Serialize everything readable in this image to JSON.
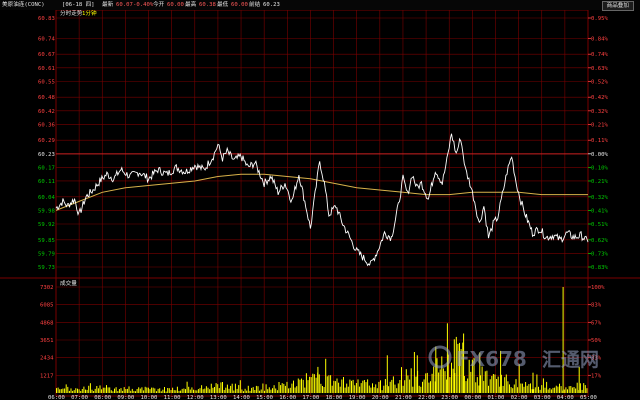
{
  "header": {
    "title": "美原油连(CONC)",
    "date": "[06-18 四]",
    "latest_label": "最新",
    "latest_value": "60.07",
    "change_value": "-0.40%",
    "today_open_label": "今开",
    "today_open_value": "60.00",
    "high_label": "最高",
    "high_value": "60.38",
    "low_label": "最低",
    "low_value": "60.00",
    "prev_settle_label": "前结",
    "prev_settle_value": "60.23",
    "add_button_label": "商品叠加"
  },
  "price_panel": {
    "title_label": "分时走势",
    "period_label": "1分钟"
  },
  "volume_panel": {
    "title_label": "成交量"
  },
  "watermark": "FX678 汇通网",
  "colors": {
    "grid": "#7a0000",
    "price_line": "#ffffff",
    "avg_line": "#d8b24a",
    "volume_bar": "#ffff00",
    "axis_red": "#ff4040",
    "axis_green": "#00c800",
    "axis_white": "#e6e6e6",
    "background": "#000000"
  },
  "chart_data": [
    {
      "type": "line",
      "title": "分时走势",
      "y_ticks": [
        "60.83",
        "60.74",
        "60.67",
        "60.61",
        "60.55",
        "60.48",
        "60.42",
        "60.36",
        "60.29",
        "60.23",
        "60.17",
        "60.11",
        "60.04",
        "59.98",
        "59.92",
        "59.85",
        "59.79",
        "59.73"
      ],
      "right_ticks": [
        "0.95%",
        "0.84%",
        "0.74%",
        "0.63%",
        "0.52%",
        "0.42%",
        "0.32%",
        "0.21%",
        "0.11%",
        "0.00%",
        "0.10%",
        "0.21%",
        "0.32%",
        "0.41%",
        "0.51%",
        "0.62%",
        "0.73%",
        "0.83%"
      ],
      "x_ticks": [
        "06:00",
        "07:00",
        "08:00",
        "09:00",
        "10:00",
        "11:00",
        "12:00",
        "13:00",
        "14:00",
        "15:00",
        "16:00",
        "17:00",
        "18:00",
        "19:00",
        "20:00",
        "21:00",
        "22:00",
        "23:00",
        "00:00",
        "01:00",
        "02:00",
        "03:00",
        "04:00",
        "05:00"
      ],
      "ylim": [
        59.73,
        60.83
      ],
      "series": [
        {
          "name": "价格",
          "points": [
            [
              0,
              59.99
            ],
            [
              0.3,
              60.02
            ],
            [
              0.5,
              60.0
            ],
            [
              0.8,
              60.03
            ],
            [
              1.0,
              59.96
            ],
            [
              1.3,
              60.04
            ],
            [
              1.6,
              60.07
            ],
            [
              1.9,
              60.11
            ],
            [
              2.2,
              60.14
            ],
            [
              2.5,
              60.12
            ],
            [
              2.8,
              60.16
            ],
            [
              3.2,
              60.13
            ],
            [
              3.6,
              60.15
            ],
            [
              4.0,
              60.12
            ],
            [
              4.4,
              60.16
            ],
            [
              4.8,
              60.14
            ],
            [
              5.2,
              60.17
            ],
            [
              5.6,
              60.15
            ],
            [
              6.0,
              60.18
            ],
            [
              6.4,
              60.16
            ],
            [
              6.8,
              60.22
            ],
            [
              7.0,
              60.27
            ],
            [
              7.2,
              60.21
            ],
            [
              7.4,
              60.24
            ],
            [
              7.7,
              60.2
            ],
            [
              8.0,
              60.22
            ],
            [
              8.3,
              60.17
            ],
            [
              8.6,
              60.19
            ],
            [
              9.0,
              60.1
            ],
            [
              9.3,
              60.13
            ],
            [
              9.6,
              60.06
            ],
            [
              9.9,
              60.1
            ],
            [
              10.2,
              60.02
            ],
            [
              10.5,
              60.14
            ],
            [
              10.8,
              60.0
            ],
            [
              11.0,
              59.9
            ],
            [
              11.2,
              60.05
            ],
            [
              11.4,
              60.2
            ],
            [
              11.6,
              60.1
            ],
            [
              11.8,
              59.96
            ],
            [
              12.1,
              60.0
            ],
            [
              12.4,
              59.92
            ],
            [
              12.7,
              59.86
            ],
            [
              13.0,
              59.8
            ],
            [
              13.3,
              59.77
            ],
            [
              13.6,
              59.74
            ],
            [
              13.9,
              59.8
            ],
            [
              14.2,
              59.88
            ],
            [
              14.5,
              59.86
            ],
            [
              14.8,
              60.0
            ],
            [
              15.0,
              60.12
            ],
            [
              15.2,
              60.05
            ],
            [
              15.4,
              60.14
            ],
            [
              15.6,
              60.08
            ],
            [
              15.8,
              60.1
            ],
            [
              16.1,
              60.03
            ],
            [
              16.4,
              60.16
            ],
            [
              16.7,
              60.1
            ],
            [
              16.9,
              60.2
            ],
            [
              17.1,
              60.32
            ],
            [
              17.3,
              60.23
            ],
            [
              17.5,
              60.3
            ],
            [
              17.7,
              60.16
            ],
            [
              17.9,
              60.1
            ],
            [
              18.1,
              60.02
            ],
            [
              18.3,
              59.92
            ],
            [
              18.5,
              60.0
            ],
            [
              18.7,
              59.86
            ],
            [
              18.9,
              59.92
            ],
            [
              19.1,
              59.95
            ],
            [
              19.3,
              60.05
            ],
            [
              19.5,
              60.15
            ],
            [
              19.7,
              60.22
            ],
            [
              19.9,
              60.1
            ],
            [
              20.1,
              60.02
            ],
            [
              20.3,
              59.96
            ],
            [
              20.6,
              59.88
            ],
            [
              20.9,
              59.9
            ],
            [
              21.2,
              59.86
            ],
            [
              21.5,
              59.87
            ],
            [
              21.8,
              59.85
            ],
            [
              22.1,
              59.88
            ],
            [
              22.4,
              59.86
            ],
            [
              22.7,
              59.87
            ],
            [
              23.0,
              59.84
            ]
          ]
        },
        {
          "name": "均价",
          "points": [
            [
              0,
              59.98
            ],
            [
              1,
              60.02
            ],
            [
              2,
              60.06
            ],
            [
              3,
              60.08
            ],
            [
              4,
              60.09
            ],
            [
              5,
              60.1
            ],
            [
              6,
              60.11
            ],
            [
              7,
              60.13
            ],
            [
              8,
              60.14
            ],
            [
              9,
              60.14
            ],
            [
              10,
              60.13
            ],
            [
              11,
              60.12
            ],
            [
              12,
              60.1
            ],
            [
              13,
              60.08
            ],
            [
              14,
              60.07
            ],
            [
              15,
              60.06
            ],
            [
              16,
              60.05
            ],
            [
              17,
              60.05
            ],
            [
              18,
              60.06
            ],
            [
              19,
              60.06
            ],
            [
              20,
              60.06
            ],
            [
              21,
              60.05
            ],
            [
              22,
              60.05
            ],
            [
              23,
              60.05
            ]
          ]
        }
      ]
    },
    {
      "type": "bar",
      "title": "成交量",
      "y_ticks": [
        "7302",
        "6085",
        "4868",
        "3651",
        "2434",
        "1217"
      ],
      "right_ticks": [
        "100%",
        "83%",
        "67%",
        "50%",
        "33%",
        "17%"
      ],
      "ylim": [
        0,
        7302
      ],
      "profile": [
        [
          0,
          300
        ],
        [
          2,
          450
        ],
        [
          4,
          350
        ],
        [
          6,
          420
        ],
        [
          7,
          700
        ],
        [
          8,
          450
        ],
        [
          9,
          500
        ],
        [
          10,
          700
        ],
        [
          11,
          1200
        ],
        [
          12,
          1000
        ],
        [
          13,
          900
        ],
        [
          14,
          700
        ],
        [
          15,
          1500
        ],
        [
          16,
          1300
        ],
        [
          16.5,
          2000
        ],
        [
          17,
          2300
        ],
        [
          17.4,
          3500
        ],
        [
          17.8,
          2200
        ],
        [
          18.2,
          1800
        ],
        [
          18.6,
          1300
        ],
        [
          19.2,
          1100
        ],
        [
          20,
          900
        ],
        [
          21,
          700
        ],
        [
          22,
          500
        ],
        [
          23,
          700
        ]
      ],
      "spikes": [
        [
          11.3,
          1800
        ],
        [
          14.3,
          2600
        ],
        [
          15.6,
          2600
        ],
        [
          16.4,
          3200
        ],
        [
          16.9,
          4800
        ],
        [
          17.2,
          3700
        ],
        [
          17.6,
          4100
        ],
        [
          18.3,
          2800
        ],
        [
          19.2,
          2900
        ],
        [
          20.6,
          1400
        ],
        [
          21.9,
          7302
        ],
        [
          22.6,
          1800
        ]
      ]
    }
  ]
}
